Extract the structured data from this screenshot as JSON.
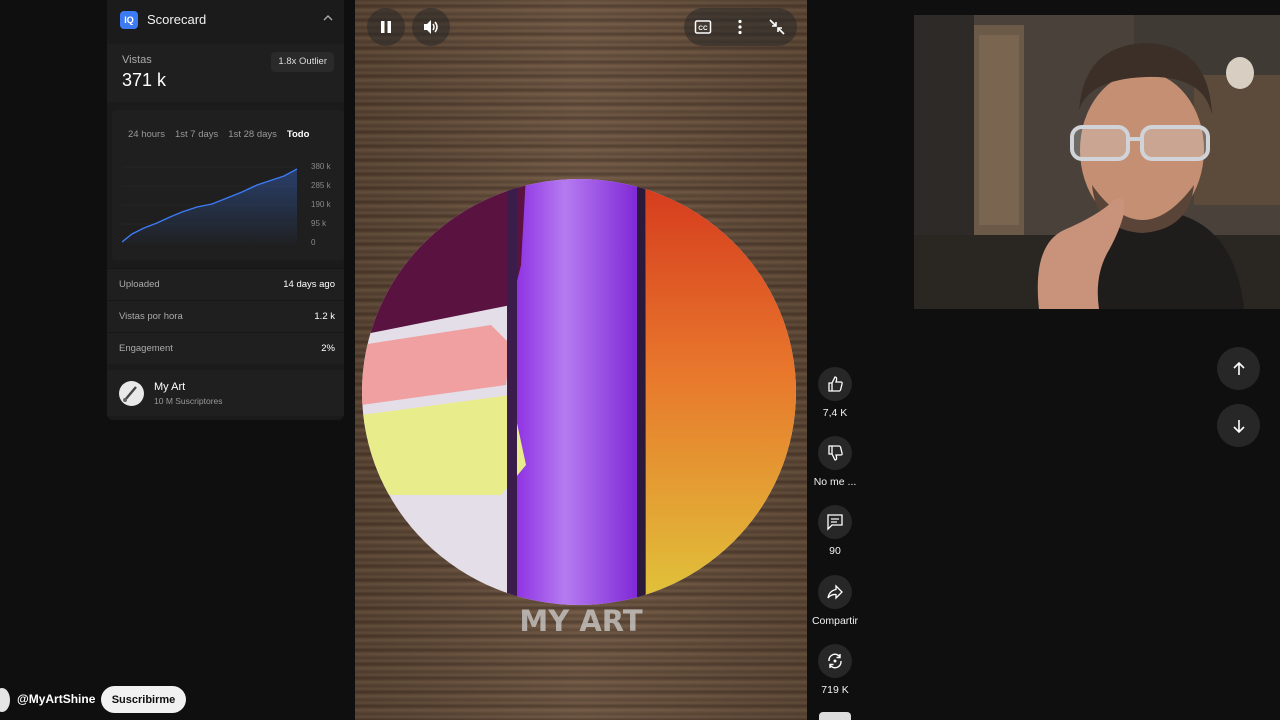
{
  "scorecard": {
    "logo": "IQ",
    "title": "Scorecard",
    "views_label": "Vistas",
    "views_value": "371 k",
    "outlier_badge": "1.8x Outlier",
    "tabs": [
      "24 hours",
      "1st 7 days",
      "1st 28 days",
      "Todo"
    ],
    "active_tab": "Todo",
    "y_ticks": [
      "380 k",
      "285 k",
      "190 k",
      "95 k",
      "0"
    ],
    "stats": [
      {
        "label": "Uploaded",
        "value": "14 days ago"
      },
      {
        "label": "Vistas por hora",
        "value": "1.2 k"
      },
      {
        "label": "Engagement",
        "value": "2%"
      }
    ],
    "channel": {
      "name": "My Art",
      "subs": "10 M Suscriptores"
    },
    "accent_color": "#3d7bf5"
  },
  "video": {
    "watermark": "MY ART",
    "controls": [
      "pause-icon",
      "volume-icon",
      "captions-icon",
      "more-icon",
      "exit-fullscreen-icon"
    ]
  },
  "actions": [
    {
      "icon": "thumbs-up-icon",
      "label": "7,4 K"
    },
    {
      "icon": "thumbs-down-icon",
      "label": "No me ..."
    },
    {
      "icon": "comment-icon",
      "label": "90"
    },
    {
      "icon": "share-icon",
      "label": "Compartir"
    },
    {
      "icon": "remix-icon",
      "label": "719 K"
    }
  ],
  "navigation": {
    "up": "arrow-up-icon",
    "down": "arrow-down-icon"
  },
  "channel_footer": {
    "handle": "@MyArtShine",
    "subscribe_label": "Suscribirme"
  }
}
